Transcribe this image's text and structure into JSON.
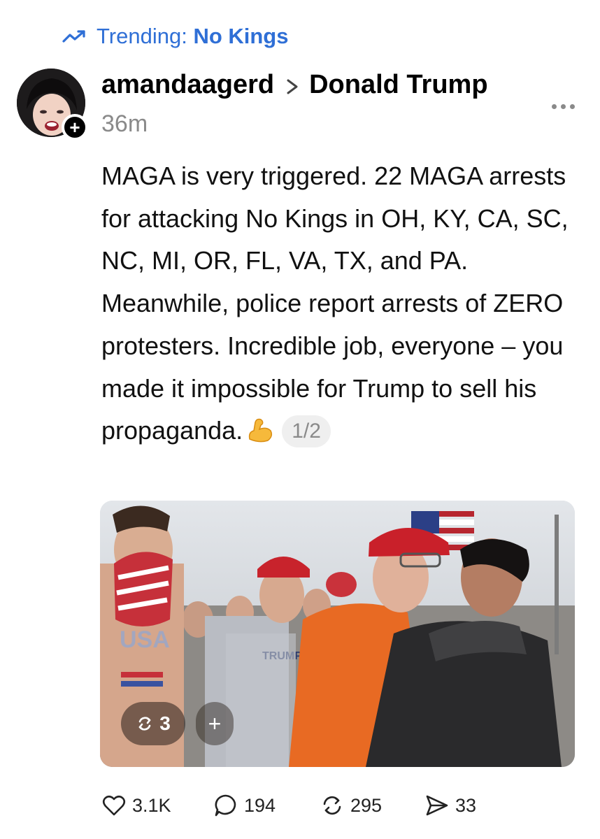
{
  "trending": {
    "prefix": "Trending:",
    "topic": "No Kings",
    "icon": "trending-up-icon",
    "color": "#2f6fd6"
  },
  "post": {
    "author": "amandaagerd",
    "community": "Donald Trump",
    "timestamp": "36m",
    "text": "MAGA is very triggered. 22 MAGA arrests for attacking No Kings in OH, KY, CA, SC, NC, MI, OR, FL, VA, TX, and PA. Meanwhile, police report arrests of ZERO protesters. Incredible job, everyone – you made it impossible for Trump to sell his propaganda.",
    "emoji": "flexed-biceps-emoji",
    "page_indicator": "1/2",
    "media": {
      "repost_count": "3",
      "add_label": "+",
      "image_text": {
        "shirt": "TRUMP",
        "chest": "USA"
      }
    }
  },
  "actions": {
    "likes": "3.1K",
    "replies": "194",
    "reposts": "295",
    "shares": "33"
  },
  "colors": {
    "secondary_text": "#8a8a8a",
    "link": "#2f6fd6"
  }
}
